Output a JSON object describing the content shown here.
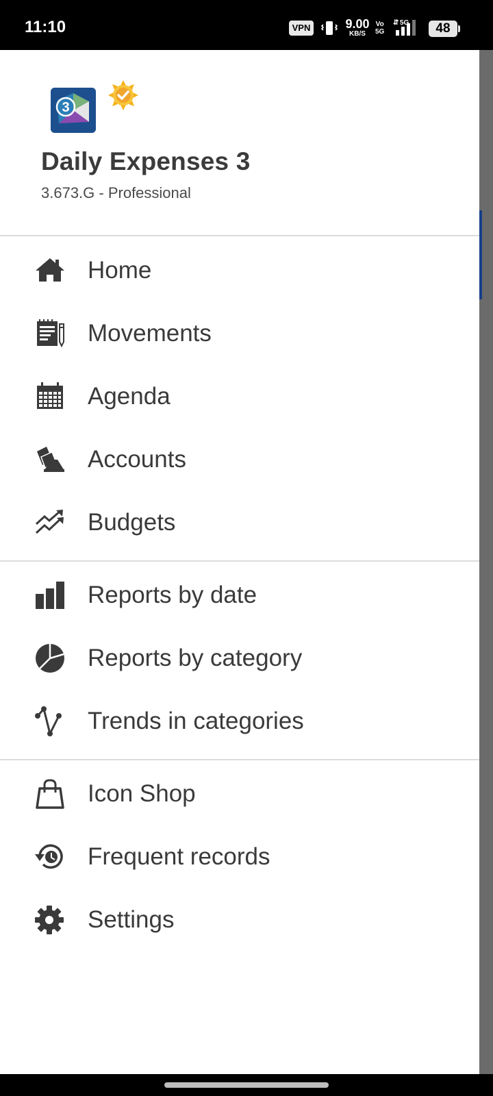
{
  "status_bar": {
    "time": "11:10",
    "vpn": "VPN",
    "net_speed": "9.00",
    "net_speed_unit": "KB/S",
    "volte_top": "Vo",
    "volte_bottom": "5G",
    "network": "5G",
    "battery": "48"
  },
  "header": {
    "app_name": "Daily Expenses 3",
    "version": "3.673.G - Professional",
    "logo_digit": "3"
  },
  "menu": {
    "home": "Home",
    "movements": "Movements",
    "agenda": "Agenda",
    "accounts": "Accounts",
    "budgets": "Budgets",
    "reports_by_date": "Reports by date",
    "reports_by_category": "Reports by category",
    "trends_in_categories": "Trends in categories",
    "icon_shop": "Icon Shop",
    "frequent_records": "Frequent records",
    "settings": "Settings"
  },
  "colors": {
    "icon": "#3a3a3a",
    "text": "#3a3a3a",
    "divider": "#dcdcdc",
    "scrim": "#6b6b6b",
    "logo_bg": "#1d4f8f"
  }
}
